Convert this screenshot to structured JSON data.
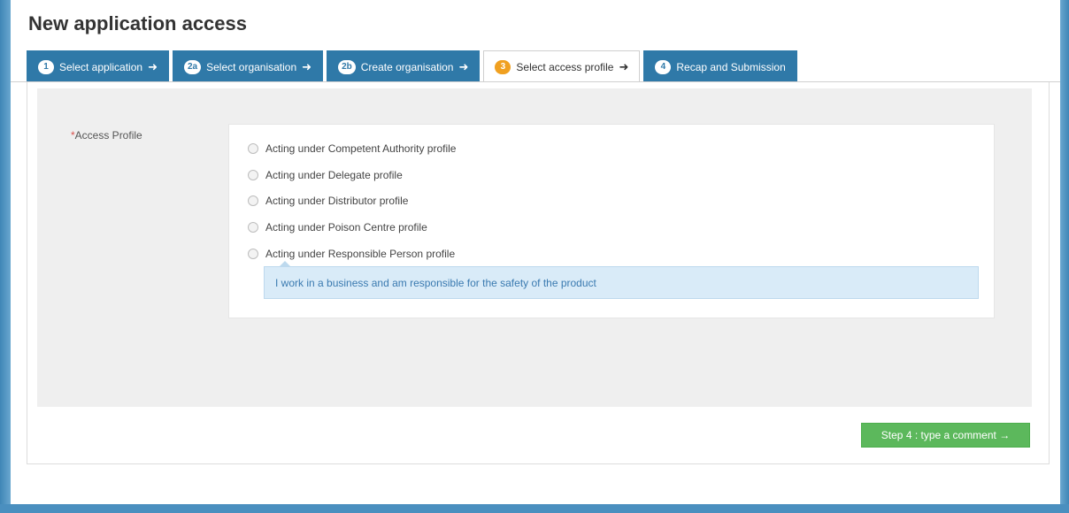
{
  "page": {
    "title": "New application access"
  },
  "tabs": [
    {
      "badge": "1",
      "label": "Select application",
      "arrow": "➜"
    },
    {
      "badge": "2a",
      "label": "Select organisation",
      "arrow": "➜"
    },
    {
      "badge": "2b",
      "label": "Create organisation",
      "arrow": "➜"
    },
    {
      "badge": "3",
      "label": "Select access profile",
      "arrow": "➜",
      "active": true
    },
    {
      "badge": "4",
      "label": "Recap and Submission",
      "arrow": ""
    }
  ],
  "form": {
    "required_mark": "*",
    "field_label": "Access Profile",
    "options": [
      {
        "label": "Acting under Competent Authority profile"
      },
      {
        "label": "Acting under Delegate profile"
      },
      {
        "label": "Acting under Distributor profile"
      },
      {
        "label": "Acting under Poison Centre profile"
      },
      {
        "label": "Acting under Responsible Person profile"
      }
    ],
    "hint": "I work in a business and am responsible for the safety of the product"
  },
  "actions": {
    "next_label": "Step 4 : type a comment →"
  },
  "colors": {
    "tab_bg": "#2f79a8",
    "active_badge": "#f0a020",
    "next_button": "#5cb85c",
    "hint_bg": "#d9ebf8"
  }
}
